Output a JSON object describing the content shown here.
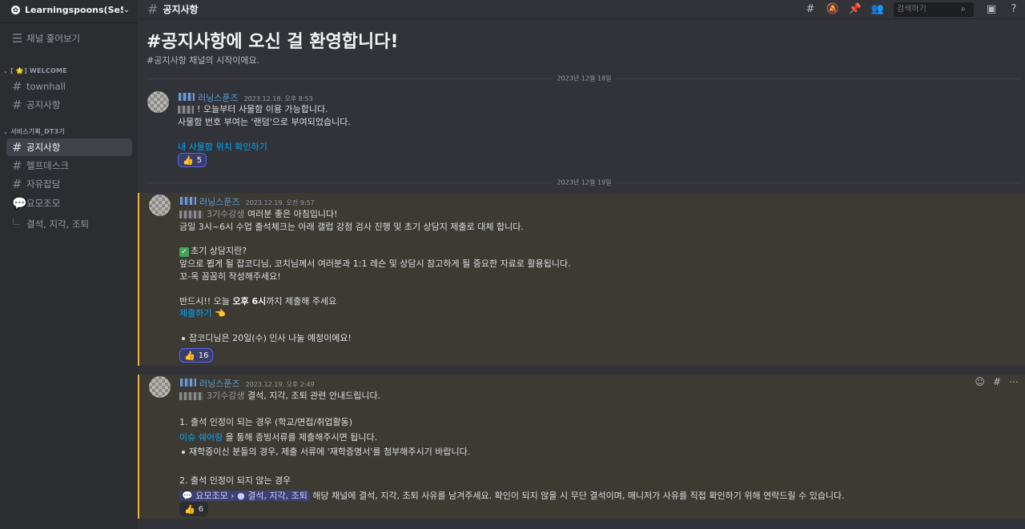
{
  "server": {
    "name": "Learningspoons(SeS...",
    "icon_glyph": "✿"
  },
  "sidebar": {
    "browse_label": "채널 훑어보기",
    "categories": [
      {
        "label": "[ 🌟] WELCOME"
      },
      {
        "label": "서비스기획_DT3기"
      }
    ],
    "channels": [
      {
        "label": "townhall"
      },
      {
        "label": "공지사항"
      },
      {
        "label": "공지사항"
      },
      {
        "label": "헬프데스크"
      },
      {
        "label": "자유잡담"
      },
      {
        "label": "요모조모"
      }
    ],
    "thread": {
      "label": "결석, 지각, 조퇴"
    }
  },
  "topbar": {
    "channel_title": "공지사항",
    "search_placeholder": "검색하기"
  },
  "welcome": {
    "title": "#공지사항에 오신 걸 환영합니다!",
    "subtitle": "#공지사항 채널의 시작이에요."
  },
  "dividers": [
    "2023년 12월 18일",
    "2023년 12월 19일"
  ],
  "messages": [
    {
      "author": "러닝스푼즈",
      "timestamp": "2023.12.18. 오후 8:53",
      "lines": [
        "! 오늘부터 사물함 이용 가능합니다.",
        "사물함 번호 부여는 '랜덤'으로 부여되었습니다."
      ],
      "link": "내 사물함 위치 확인하기",
      "reaction": {
        "emoji": "👍",
        "count": "5"
      }
    },
    {
      "author": "러닝스푼즈",
      "timestamp": "2023.12.19. 오전 9:57",
      "mention_suffix": "3기수강생",
      "lines": [
        "여러분 좋은 아침입니다!",
        "금일 3시~6시 수업 출석체크는 아래 갤럽 강점 검사 진행 및 초기 상담지 제출로 대체 합니다.",
        "초기 상담지란?",
        "앞으로 뵙게 될 잡코디님, 코치님께서 여러분과 1:1 레슨 및 상담시 참고하게 될 중요한 자료로 활용됩니다.",
        "꼬-옥 꼼꼼히 작성해주세요!",
        "반드시!! 오늘 ",
        "오후 6시",
        "까지 제출해 주세요",
        "잡코디님은 20일(수) 인사 나눌 예정이에요!"
      ],
      "link": "제출하기",
      "link_emoji": "👈",
      "reaction": {
        "emoji": "👍",
        "count": "16"
      }
    },
    {
      "author": "러닝스푼즈",
      "timestamp": "2023.12.19. 오후 2:49",
      "mention_suffix": "3기수강생",
      "lines": [
        "결석, 지각, 조퇴 관련 안내드립니다.",
        "1. 출석 인정이 되는 경우 (학교/면접/취업활동)",
        "을 통해 증빙서류를 제출해주시면 됩니다.",
        "재학중이신 분들의 경우, 제출 서류에 '재학증명서'를 첨부해주시기 바랍니다.",
        "2. 출석 인정이 되지 않는 경우",
        "해당 채널에 결석, 지각, 조퇴 사유를 남겨주세요. 확인이 되지 않을 시 무단 결석이며, 매니저가 사유를 직접 확인하기 위해 연락드릴 수 있습니다."
      ],
      "link": "이슈 쉐어링",
      "channel_mention_a": "요모조모",
      "channel_mention_b": "결석, 지각, 조퇴",
      "reaction": {
        "emoji": "👍",
        "count": "6"
      }
    }
  ],
  "colors": {
    "accent": "#5865f2",
    "link": "#00a8fc",
    "highlight_bar": "#f0b232",
    "author": "#5b9bd5"
  }
}
